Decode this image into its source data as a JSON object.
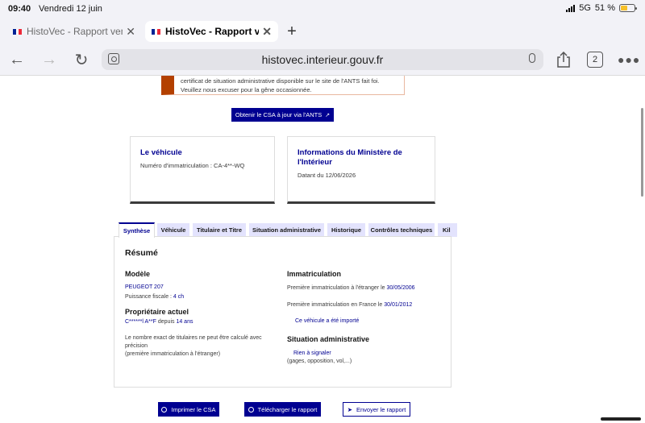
{
  "status": {
    "time": "09:40",
    "date": "Vendredi 12 juin",
    "network": "5G",
    "battery": "51 %",
    "battery_level": 0.51
  },
  "browser": {
    "tabs": [
      {
        "label": "HistoVec - Rapport vend"
      },
      {
        "label": "HistoVec - Rapport vend"
      }
    ],
    "url": "histovec.interieur.gouv.fr",
    "tab_count": "2"
  },
  "colors": {
    "accent": "#000091",
    "warning": "#b34000",
    "tab_bg": "#e3e3fd"
  },
  "alert": {
    "line1": "certificat de situation administrative disponible sur le site de l'ANTS fait foi.",
    "line2": "Veuillez nous excuser pour la gêne occasionnée."
  },
  "csa_button": "Obtenir le CSA à jour via l'ANTS",
  "cards": {
    "vehicle": {
      "title": "Le véhicule",
      "desc": "Numéro d'immatriculation : CA-4**-WQ"
    },
    "ministry": {
      "title_line1": "Informations du Ministère de",
      "title_line2": "l'Intérieur",
      "desc": "Datant du 12/06/2026"
    }
  },
  "tabs": [
    "Synthèse",
    "Véhicule",
    "Titulaire et Titre",
    "Situation administrative",
    "Historique",
    "Contrôles techniques",
    "Kil"
  ],
  "summary": {
    "title": "Résumé",
    "model": {
      "heading": "Modèle",
      "name": "PEUGEOT 207",
      "power_label": "Puissance fiscale : ",
      "power_value": "4 ch"
    },
    "owner": {
      "heading": "Propriétaire actuel",
      "name": "C******l A**F",
      "since_label": " depuis ",
      "since_value": "14 ans",
      "note_line1": "Le nombre exact de titulaires ne peut être calculé avec",
      "note_line2": "précision",
      "note_line3": "(première immatriculation à l'étranger)"
    },
    "registration": {
      "heading": "Immatriculation",
      "abroad_label": "Première immatriculation à l'étranger le ",
      "abroad_date": "30/05/2006",
      "france_label": "Première immatriculation en France le ",
      "france_date": "30/01/2012",
      "imported": "Ce véhicule a été importé"
    },
    "admin": {
      "heading": "Situation administrative",
      "status": "Rien à signaler",
      "details": "(gages, opposition, vol,...)"
    }
  },
  "actions": {
    "print": "Imprimer le CSA",
    "download": "Télécharger le rapport",
    "send": "Envoyer le rapport"
  }
}
